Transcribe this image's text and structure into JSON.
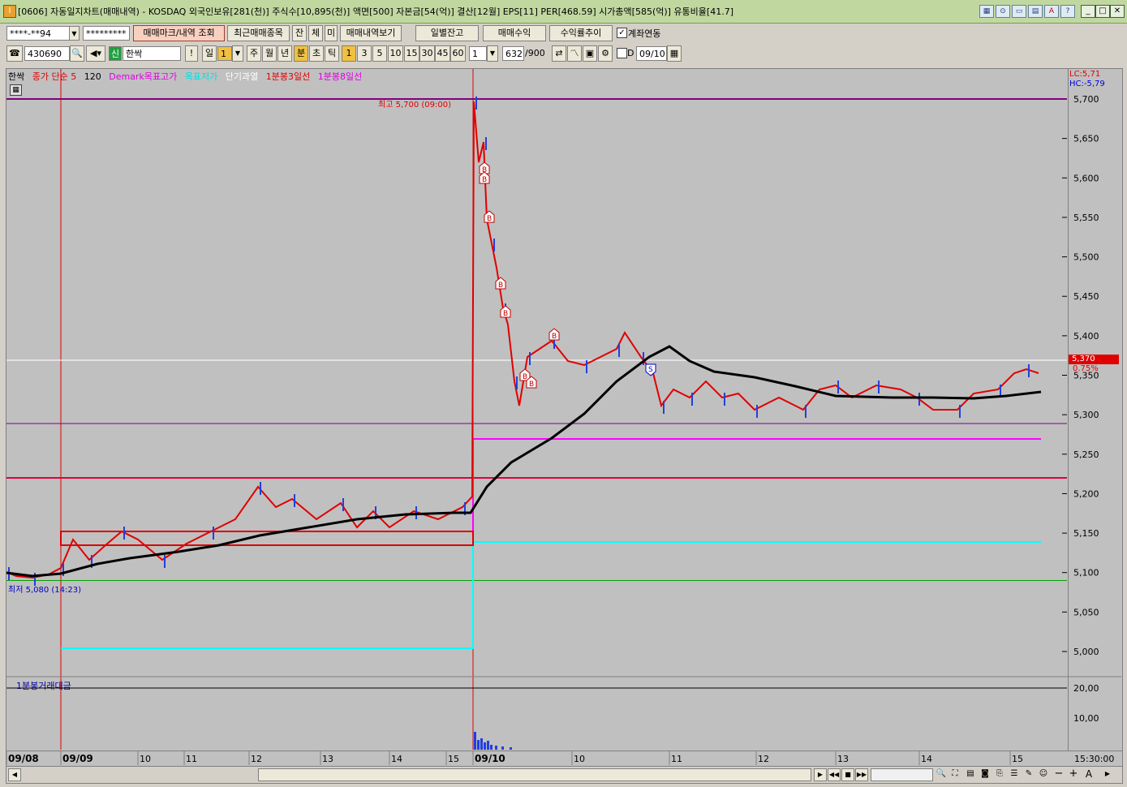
{
  "window": {
    "title": "[0606] 자동일지차트(매매내역) - KOSDAQ 외국인보유[281(천)] 주식수[10,895(천)] 액면[500] 자본금[54(억)] 결산[12월] EPS[11] PER[468.59] 시가총액[585(억)] 유통비율[41.7]",
    "app_icon": "I"
  },
  "toolbar1": {
    "account": "****-**94",
    "password": "*********",
    "buttons": [
      "매매마크/내역 조회",
      "최근매매종목",
      "잔",
      "체",
      "미",
      "매매내역보기",
      "일별잔고",
      "매매수익",
      "수익률추이"
    ],
    "link_label": "계좌연동",
    "link_checked": true
  },
  "toolbar2": {
    "code": "430690",
    "badge": "신",
    "name": "한싹",
    "excl": "!",
    "period_label": "일",
    "period_value": "1",
    "periods": [
      "주",
      "월",
      "년",
      "분",
      "초",
      "틱"
    ],
    "intervals": [
      "1",
      "3",
      "5",
      "10",
      "15",
      "30",
      "45",
      "60"
    ],
    "interval_value": "1",
    "count": "632",
    "count_total": "/900",
    "d_label": "D",
    "date": "09/10"
  },
  "legend": {
    "items": [
      {
        "text": "한싹",
        "color": "#000000"
      },
      {
        "text": "종가 단순 5",
        "color": "#e00000"
      },
      {
        "text": "120",
        "color": "#000000"
      },
      {
        "text": "Demark목표고가",
        "color": "#e000e0"
      },
      {
        "text": "목표저가",
        "color": "#00e0e0"
      },
      {
        "text": "단기과열",
        "color": "#ffffff"
      },
      {
        "text": "1분봉3일선",
        "color": "#e00000"
      },
      {
        "text": "1분봉8일선",
        "color": "#e000e0"
      }
    ],
    "volume_title": "1분봉거래대금"
  },
  "annotations": {
    "high": "최고 5,700 (09:00)",
    "low": "최저 5,080 (14:23)",
    "lc": "LC:5,71",
    "hc": "HC:-5,79",
    "current_price": "5,370",
    "current_pct": "0.75%",
    "buy_marker": "B",
    "sell_marker": "S"
  },
  "chart_data": {
    "type": "line",
    "y_ticks": [
      "5,700",
      "5,650",
      "5,600",
      "5,550",
      "5,500",
      "5,450",
      "5,400",
      "5,350",
      "5,300",
      "5,250",
      "5,200",
      "5,150",
      "5,100",
      "5,050",
      "5,000"
    ],
    "ylim": [
      5000,
      5700
    ],
    "volume_ticks": [
      "20,00",
      "10,00"
    ],
    "x_ticks": [
      "09/08",
      "09/09",
      "10",
      "11",
      "12",
      "13",
      "14",
      "15",
      "09/10",
      "10",
      "11",
      "12",
      "13",
      "14",
      "15",
      "15:30:00"
    ],
    "lines": {
      "demark_high": 5290,
      "target_low": 5140,
      "upper_red": 5220,
      "green": 5090
    }
  },
  "colors": {
    "bg": "#c0c0c0",
    "up": "#e00000",
    "down": "#2040e0",
    "ma": "#000000",
    "magenta": "#ff00ff",
    "cyan": "#00ffff",
    "purple": "#800080"
  }
}
